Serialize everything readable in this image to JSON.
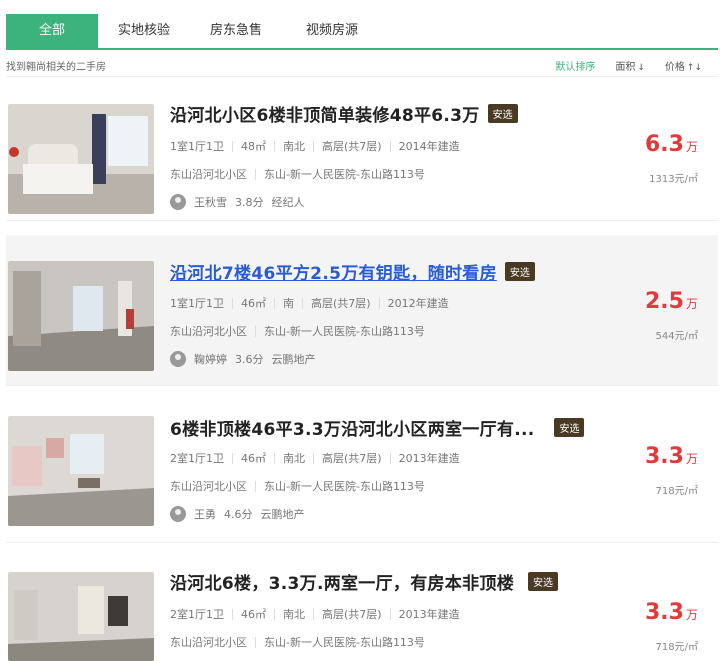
{
  "tabs": [
    {
      "label": "全部",
      "active": true
    },
    {
      "label": "实地核验",
      "active": false
    },
    {
      "label": "房东急售",
      "active": false
    },
    {
      "label": "视频房源",
      "active": false
    }
  ],
  "subbar": {
    "found_text": "找到翱尚相关的二手房",
    "sorts": [
      {
        "label": "默认排序",
        "active": true
      },
      {
        "label": "面积",
        "arrow": "↓"
      },
      {
        "label": "价格",
        "arrow": "↑↓"
      }
    ]
  },
  "listings": [
    {
      "title": "沿河北小区6楼非顶简单装修48平6.3万",
      "badge": "安选",
      "layout": "1室1厅1卫",
      "area": "48㎡",
      "orientation": "南北",
      "floor": "高层(共7层)",
      "built": "2014年建造",
      "community": "东山沿河北小区",
      "location": "东山-新一人民医院-东山路113号",
      "agent": "王秋雪",
      "score": "3.8分",
      "agency": "经纪人",
      "price": "6.3",
      "price_unit": "万",
      "unit_price": "1313元/㎡"
    },
    {
      "title": "沿河北7楼46平方2.5万有钥匙，随时看房",
      "badge": "安选",
      "layout": "1室1厅1卫",
      "area": "46㎡",
      "orientation": "南",
      "floor": "高层(共7层)",
      "built": "2012年建造",
      "community": "东山沿河北小区",
      "location": "东山-新一人民医院-东山路113号",
      "agent": "鞠婷婷",
      "score": "3.6分",
      "agency": "云鹏地产",
      "price": "2.5",
      "price_unit": "万",
      "unit_price": "544元/㎡"
    },
    {
      "title": "6楼非顶楼46平3.3万沿河北小区两室一厅有...",
      "badge": "安选",
      "layout": "2室1厅1卫",
      "area": "46㎡",
      "orientation": "南北",
      "floor": "高层(共7层)",
      "built": "2013年建造",
      "community": "东山沿河北小区",
      "location": "东山-新一人民医院-东山路113号",
      "agent": "王勇",
      "score": "4.6分",
      "agency": "云鹏地产",
      "price": "3.3",
      "price_unit": "万",
      "unit_price": "718元/㎡"
    },
    {
      "title": "沿河北6楼，3.3万.两室一厅，有房本非顶楼",
      "badge": "安选",
      "layout": "2室1厅1卫",
      "area": "46㎡",
      "orientation": "南北",
      "floor": "高层(共7层)",
      "built": "2013年建造",
      "community": "东山沿河北小区",
      "location": "东山-新一人民医院-东山路113号",
      "price": "3.3",
      "price_unit": "万",
      "unit_price": "718元/㎡"
    }
  ],
  "colors": {
    "accent": "#3db37c",
    "price": "#e4393c",
    "badge": "#4a3a24",
    "link": "#2a5bd7"
  }
}
